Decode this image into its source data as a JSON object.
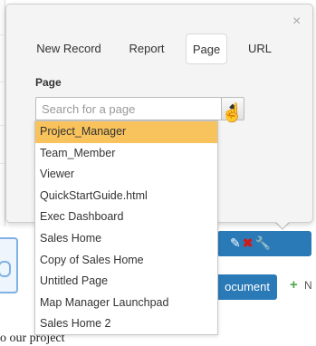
{
  "popover": {
    "close_symbol": "×",
    "tabs": [
      {
        "label": "New Record"
      },
      {
        "label": "Report"
      },
      {
        "label": "Page"
      },
      {
        "label": "URL"
      }
    ],
    "active_tab": "Page",
    "section_label": "Page",
    "search": {
      "placeholder": "Search for a page",
      "value": ""
    },
    "dropdown_icon": "◆",
    "page_options": [
      "Project_Manager",
      "Team_Member",
      "Viewer",
      "QuickStartGuide.html",
      "Exec Dashboard",
      "Sales Home",
      "Copy of Sales Home",
      "Untitled Page",
      "Map Manager Launchpad",
      "Sales Home 2"
    ],
    "selected_option": "Project_Manager"
  },
  "background": {
    "document_button_label": "ocument",
    "plus_symbol": "+",
    "plus_label": "N",
    "caption_fragment": "o our project"
  },
  "colors": {
    "selected_row": "#f8c25c",
    "accent_blue": "#2a7ab8",
    "popover_bg": "#f4f4f4"
  }
}
